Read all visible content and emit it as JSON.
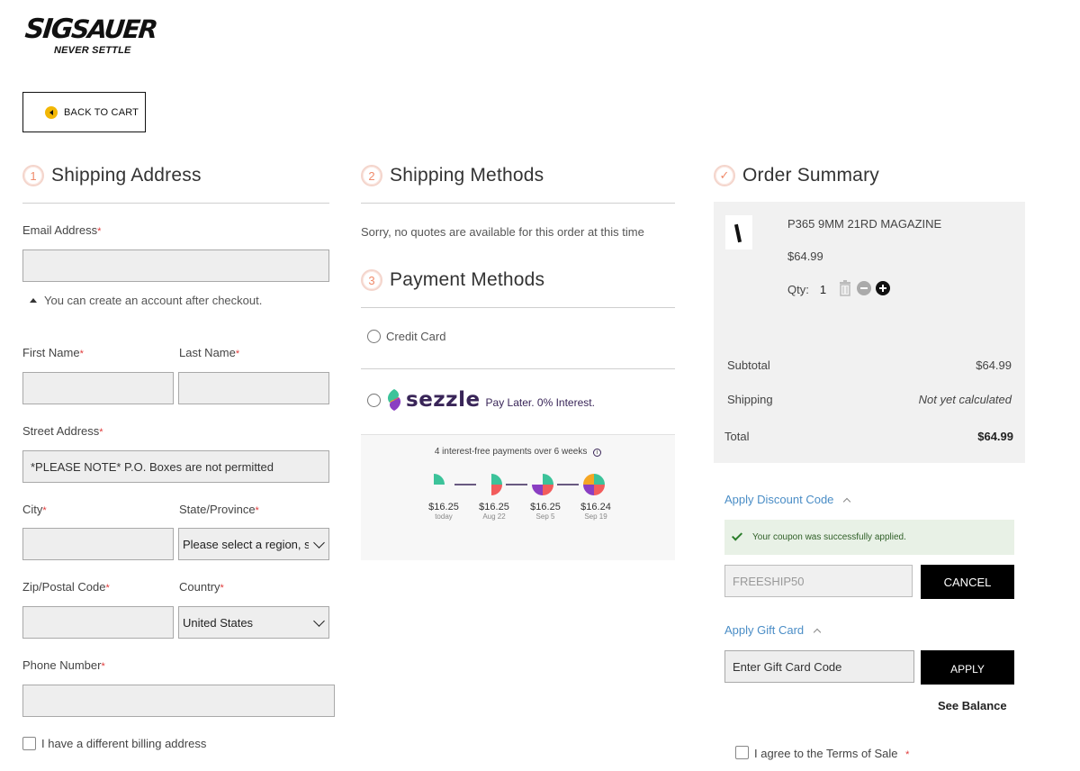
{
  "brand": {
    "name": "SIG SAUER",
    "name_part1": "SIG",
    "name_part2": "SAUER",
    "tagline": "NEVER SETTLE"
  },
  "back_to_cart": "BACK TO CART",
  "shipping_address": {
    "step": "1",
    "title": "Shipping Address",
    "email_label": "Email Address",
    "email_value": "",
    "account_hint": "You can create an account after checkout.",
    "first_name_label": "First Name",
    "last_name_label": "Last Name",
    "street_label": "Street Address",
    "street_placeholder": "*PLEASE NOTE* P.O. Boxes are not permitted",
    "city_label": "City",
    "state_label": "State/Province",
    "state_selected": "Please select a region, state or province.",
    "zip_label": "Zip/Postal Code",
    "country_label": "Country",
    "country_selected": "United States",
    "phone_label": "Phone Number",
    "billing_checkbox": "I have a different billing address",
    "required_mark": "*"
  },
  "shipping_methods": {
    "step": "2",
    "title": "Shipping Methods",
    "message": "Sorry, no quotes are available for this order at this time"
  },
  "payment_methods": {
    "step": "3",
    "title": "Payment Methods",
    "credit_card": "Credit Card",
    "sezzle": {
      "logo_text": "sezzle",
      "tagline": "Pay Later. 0% Interest.",
      "note": "4 interest-free payments over 6 weeks",
      "info_icon": "info-icon",
      "payments": [
        {
          "amount": "$16.25",
          "date": "today"
        },
        {
          "amount": "$16.25",
          "date": "Aug 22"
        },
        {
          "amount": "$16.25",
          "date": "Sep 5"
        },
        {
          "amount": "$16.24",
          "date": "Sep 19"
        }
      ],
      "colors": {
        "green": "#3cc39a",
        "red": "#f25c5c",
        "purple": "#8a3ec2",
        "orange": "#f5a623"
      }
    }
  },
  "order_summary": {
    "step_mark": "✓",
    "title": "Order Summary",
    "item_name": "P365 9MM 21RD MAGAZINE",
    "item_price": "$64.99",
    "qty_label": "Qty:",
    "qty_value": "1",
    "subtotal_label": "Subtotal",
    "subtotal_value": "$64.99",
    "shipping_label": "Shipping",
    "shipping_value": "Not yet calculated",
    "total_label": "Total",
    "total_value": "$64.99"
  },
  "discount": {
    "toggle_label": "Apply Discount Code",
    "success_message": "Your coupon was successfully applied.",
    "code_value": "FREESHIP50",
    "cancel_label": "CANCEL"
  },
  "gift_card": {
    "toggle_label": "Apply Gift Card",
    "placeholder": "Enter Gift Card Code",
    "apply_label": "APPLY",
    "see_balance": "See Balance"
  },
  "terms": {
    "label": "I agree to the Terms of Sale",
    "required_mark": "*"
  },
  "colors": {
    "accent_step": "#f08a6a",
    "link": "#4a8dc6",
    "button_black": "#000000",
    "success_bg": "#e8f1e6"
  }
}
